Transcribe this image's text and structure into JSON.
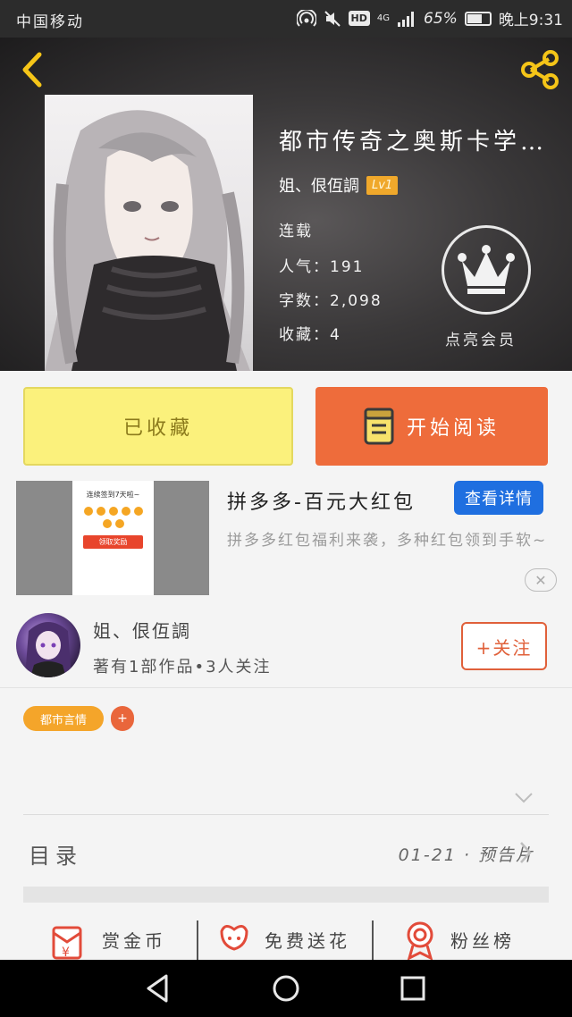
{
  "status_bar": {
    "carrier": "中国移动",
    "network": "4G",
    "hd": "HD",
    "battery_percent": "65%",
    "battery_level": 0.65,
    "time": "晚上9:31"
  },
  "header": {
    "back_icon": "chevron-left-icon",
    "share_icon": "share-icon",
    "accent_color": "#f5c518"
  },
  "book": {
    "title": "都市传奇之奥斯卡学…",
    "author": "姐、佷仾調",
    "level": "Lv1",
    "status": "连载",
    "popularity": "人气：191",
    "word_count": "字数：2,098",
    "favorites": "收藏：4"
  },
  "vip": {
    "icon": "crown-icon",
    "label": "点亮会员"
  },
  "actions": {
    "collected_label": "已收藏",
    "read_label": "开始阅读",
    "read_color": "#ee6c3b",
    "collected_color": "#fbf17c"
  },
  "ad": {
    "title": "拼多多-百元大红包",
    "cta": "查看详情",
    "description": "拼多多红包福利来袭，多种红包领到手软~",
    "image_caption": "连续签到7天啦~",
    "image_button": "领取奖励"
  },
  "author_card": {
    "name": "姐、佷仾調",
    "stats": "著有1部作品•3人关注",
    "follow_label": "+关注"
  },
  "tags": {
    "items": [
      "都市言情"
    ],
    "add_label": "+"
  },
  "toc": {
    "label": "目录",
    "latest": "01-21 · 预告片"
  },
  "bottom_actions": [
    {
      "label": "赏金币",
      "icon": "red-envelope-icon"
    },
    {
      "label": "免费送花",
      "icon": "flower-icon"
    },
    {
      "label": "粉丝榜",
      "icon": "medal-icon"
    }
  ],
  "nav": {
    "back": "nav-back-icon",
    "home": "nav-home-icon",
    "recents": "nav-recents-icon"
  }
}
